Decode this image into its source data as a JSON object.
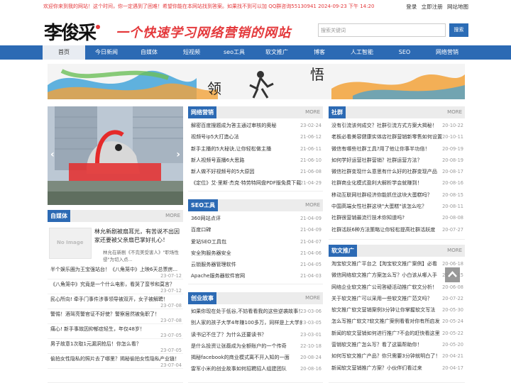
{
  "topbar": {
    "notice": "欢迎你来到我的网站！这个时间，你一定遇到了困难！希望你能在本网站找到答案。如果找不到可以加 QQ群咨询55130941    2024-09-23    下午  14:20",
    "login": "登录",
    "register": "立即注册",
    "sitemap": "网站地图"
  },
  "header": {
    "logo": "李俊采",
    "slogan": "一个快速学习网络营销的网站",
    "search_placeholder": "搜索关键词",
    "search_button": "搜索"
  },
  "nav": [
    "首页",
    "今日新闻",
    "自媒体",
    "短视频",
    "seo工具",
    "软文推广",
    "博客",
    "人工智能",
    "SEO",
    "网络营销"
  ],
  "banner": {
    "text_left": "领",
    "text_right": "悟"
  },
  "zimeiti": {
    "title": "自媒体",
    "more": "MORE",
    "feature_title": "林允新剧被扇耳光，有苦说不出因家还要被父亲扇巴掌好扎心！",
    "feature_desc": "林允在新剧《不完美受害人》\"职场性侵\"为切入点...",
    "items": [
      {
        "title": "半个娱乐圈为王宝强站台！《八角笼中》上映6天总票房...",
        "date": "23-07-12"
      },
      {
        "title": "《八角笼中》究竟是一个什么电影，看哭了蛮爷和莫言？",
        "date": "23-07-12"
      },
      {
        "title": "民心所向! 牵手门事件涉事领导被双开，女子被解聘！",
        "date": "23-07-08"
      },
      {
        "title": "警惕！酒驾亮警官证不好使？警察居然被免职了！",
        "date": "23-07-08"
      },
      {
        "title": "痛心! 新手事故因抑郁症轻生，年仅48岁！",
        "date": "23-07-05"
      },
      {
        "title": "男子故意1次取1元漏洞抢后！你怎么看？",
        "date": "23-07-05"
      },
      {
        "title": "偷拍女性隐私的照片去了哪里？揭秘偷拍女性隐私产业链！",
        "date": "23-07-04"
      }
    ]
  },
  "wlyx": {
    "title": "网络营销",
    "more": "MORE",
    "items": [
      {
        "title": "解密百度搜题成为答主通过审核的奥秘",
        "date": "23-02-24"
      },
      {
        "title": "视频号ip5大打造心法",
        "date": "21-06-12"
      },
      {
        "title": "新手主播的5大秘诀,让你轻松做主播",
        "date": "21-06-11"
      },
      {
        "title": "新人视频号直播6大思路",
        "date": "21-06-10"
      },
      {
        "title": "新人做不好视频号的5大原因",
        "date": "21-06-08"
      },
      {
        "title": "《定位》艾·里斯·杰克·特劳特网盘PDF版免费下载",
        "date": "21-04-29"
      }
    ]
  },
  "seo": {
    "title": "SEO工具",
    "more": "MORE",
    "items": [
      {
        "title": "360网站点评",
        "date": "21-04-09"
      },
      {
        "title": "百度口碑",
        "date": "21-04-09"
      },
      {
        "title": "爱站SEO工具包",
        "date": "21-04-07"
      },
      {
        "title": "安全狗服务器安全",
        "date": "21-04-06"
      },
      {
        "title": "云锁服务器管理软件",
        "date": "21-04-05"
      },
      {
        "title": "Apache服务器软件官网",
        "date": "21-04-03"
      }
    ]
  },
  "story": {
    "title": "创业故事",
    "more": "MORE",
    "items": [
      {
        "title": "如果你现在处于低谷,不妨看看我的这些逆袭故事！",
        "date": "23-03-06"
      },
      {
        "title": "别人家的孩子大学4年赚100多万，同样是上大学差距怎么...",
        "date": "23-03-05"
      },
      {
        "title": "读书记不住了？为什么还要读书？",
        "date": "23-03-01"
      },
      {
        "title": "是什么投资让张磊成为全额账户的一个传奇",
        "date": "22-10-18"
      },
      {
        "title": "揭秘facebook的商业模式离不开入知的一面",
        "date": "20-08-24"
      },
      {
        "title": "雷军小米的创业故事如何招聘招人组建团队",
        "date": "20-08-16"
      }
    ]
  },
  "shequn": {
    "title": "社群",
    "more": "MORE",
    "items": [
      {
        "title": "没有引流该何成交？社群引流方式方案大揭秘！",
        "date": "20-10-22"
      },
      {
        "title": "老板必看美容健康实体店社群营销新零售如何设置",
        "date": "20-10-11"
      },
      {
        "title": "微信有哪些社群工具?用了他让你事半功倍！",
        "date": "20-09-19"
      },
      {
        "title": "如何学好运营社群营销？社群运营方法？",
        "date": "20-08-19"
      },
      {
        "title": "微信社群变现什么意思有什么好的社群变现产品",
        "date": "20-08-17"
      },
      {
        "title": "社群商业化模式盈利大解析学会就赚到！",
        "date": "20-08-16"
      },
      {
        "title": "移动互联网社群经济你能抓住这块大蛋糕吗？",
        "date": "20-08-15"
      },
      {
        "title": "中国高端女性社群这块\"大蛋糕\"该怎么吃？",
        "date": "20-08-11"
      },
      {
        "title": "社群很营销最流行技术你知道吗?",
        "date": "20-08-08"
      },
      {
        "title": "社群活跃6种方法策略让你轻松提高社群活跃度",
        "date": "20-07-27"
      }
    ]
  },
  "ruanwen": {
    "title": "软文推广",
    "more": "MORE",
    "items": [
      {
        "title": "淘宝软文推广平台之【淘宝软文推广案例】必看",
        "date": "20-06-18"
      },
      {
        "title": "微信网络软文推广方案怎么写？小白该从哪入手",
        "date": "20-06-15"
      },
      {
        "title": "网络企业软文推广公司答疑活动推广软文分析！",
        "date": "20-06-08"
      },
      {
        "title": "关于软文推广可以采用一些软文推广范文吗？",
        "date": "20-07-22"
      },
      {
        "title": "软文推广软文营销案例3分钟让你掌握软文写法",
        "date": "20-05-30"
      },
      {
        "title": "怎么写推广软文?软文推广案例看看对你有所启发",
        "date": "20-05-24"
      },
      {
        "title": "新闻的软文营销如何进行推广?不会的赶快看这里",
        "date": "20-05-22"
      },
      {
        "title": "营销软文推广怎么写？看了这篇帮助你！",
        "date": "20-05-20"
      },
      {
        "title": "如何写软文推广产品？你只需要3分钟就明白了！",
        "date": "20-04-21"
      },
      {
        "title": "新闻软文营销推广方案？小伙伴们看过来",
        "date": "20-04-17"
      }
    ]
  },
  "colors": {
    "primary": "#2c6ab4",
    "accent": "#e4393c"
  }
}
